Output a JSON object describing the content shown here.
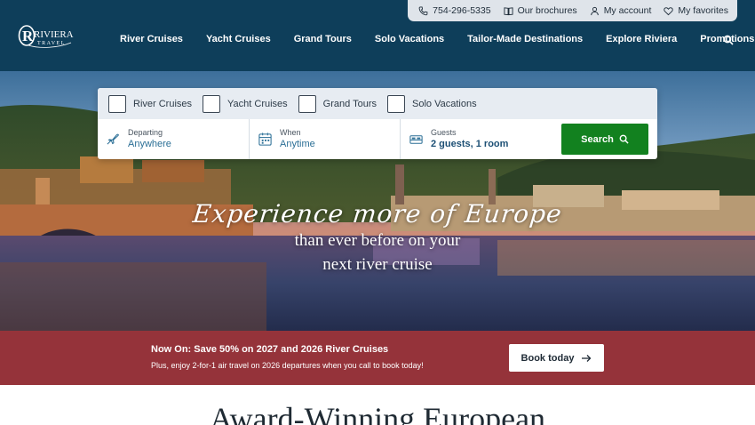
{
  "utility": {
    "phone": "754-296-5335",
    "brochures": "Our brochures",
    "account": "My account",
    "favorites": "My favorites"
  },
  "logo": {
    "name": "RIVIERA",
    "sub": "TRAVEL"
  },
  "nav": {
    "items": [
      "River Cruises",
      "Yacht Cruises",
      "Grand Tours",
      "Solo Vacations",
      "Tailor-Made Destinations",
      "Explore Riviera",
      "Promotions"
    ]
  },
  "search": {
    "tabs": [
      "River Cruises",
      "Yacht Cruises",
      "Grand Tours",
      "Solo Vacations"
    ],
    "departing": {
      "label": "Departing",
      "value": "Anywhere"
    },
    "when": {
      "label": "When",
      "value": "Anytime"
    },
    "guests": {
      "label": "Guests",
      "value": "2 guests, 1 room"
    },
    "button": "Search"
  },
  "hero": {
    "script": "Experience more of Europe",
    "line1": "than ever before on your",
    "line2": "next river cruise"
  },
  "promo": {
    "title": "Now On: Save 50% on 2027 and 2026 River Cruises",
    "text": "Plus, enjoy 2-for-1 air travel on 2026 departures when you call to book today!",
    "button": "Book today"
  },
  "section": {
    "title": "Award-Winning European"
  },
  "colors": {
    "header": "#0e3e5a",
    "search_button": "#12811f",
    "promo": "#95333a"
  }
}
